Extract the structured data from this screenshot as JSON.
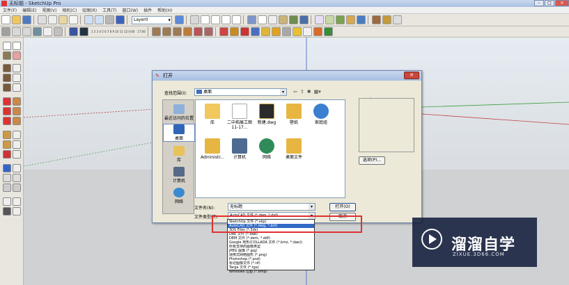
{
  "window": {
    "title": "无标题 - SketchUp Pro"
  },
  "menubar": {
    "items": [
      "文件(F)",
      "编辑(E)",
      "视图(V)",
      "相机(C)",
      "绘图(R)",
      "工具(T)",
      "窗口(W)",
      "插件",
      "帮助(H)"
    ]
  },
  "toolbar": {
    "layer_value": "Layer0",
    "ruler_text": "1 2 3 4 5 6 7 8 9 10 11 12 0:00",
    "ruler_end": "17:00"
  },
  "dialog": {
    "title": "打开",
    "close_glyph": "✕",
    "look_in_label": "查找范围(I):",
    "look_in_value": "桌面",
    "places": [
      {
        "label": "最近访问的位置"
      },
      {
        "label": "桌面"
      },
      {
        "label": "库"
      },
      {
        "label": "计算机"
      },
      {
        "label": "网络"
      }
    ],
    "files": [
      {
        "name": "库"
      },
      {
        "name": "二中拓展工图11-17..."
      },
      {
        "name": "新建.dwg"
      },
      {
        "name": "壁纸"
      },
      {
        "name": "家庭组"
      },
      {
        "name": "Administr..."
      },
      {
        "name": "计算机"
      },
      {
        "name": "网络"
      },
      {
        "name": "桌面文件"
      }
    ],
    "preview_label": "预览",
    "preview_button": "选项(P)...",
    "filename_label": "文件名(N):",
    "filename_value": "无标题",
    "filetype_label": "文件类型(T):",
    "filetype_value": "AutoCAD 文件 (*.dwg, *.dxf)",
    "open_button": "打开(O)",
    "cancel_button": "取消"
  },
  "filetype_options": [
    "SketchUp 文件 (*.skp)",
    "AutoCAD 文件 (*.dwg, *.dxf)",
    "3DS Files (*.3ds)",
    "DAE 文件 (*.dae)",
    "DEM 文件 (*.dem, *.ddf)",
    "Google 地形(COLLADA 文件 (*.kmz, *.dae))",
    "所有支持的图像类型",
    "JPEG 图像 (*.jpg)",
    "便携式网络图形 (*.png)",
    "Photoshop (*.psd)",
    "标记图像文件 (*.tif)",
    "Targa 文件 (*.tga)",
    "Windows 位图 (*.bmp)"
  ],
  "filetype_selected_index": 1,
  "watermark": {
    "name": "溜溜自学",
    "url": "ZIXUE.3D66.COM"
  },
  "colors": {
    "accent_red": "#e03030",
    "selection_blue": "#316ac5",
    "watermark_bg": "#141e3c"
  }
}
